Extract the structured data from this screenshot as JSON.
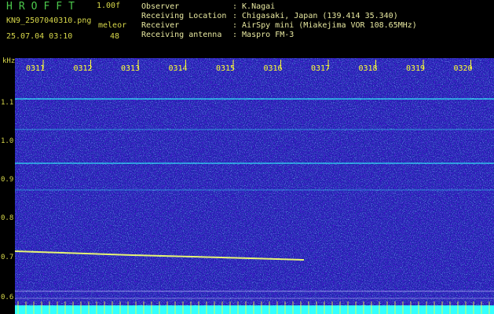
{
  "app": {
    "title": "HROFFT",
    "version": "1.00f"
  },
  "file": {
    "name": "KN9_2507040310.png",
    "mode": "meleor",
    "timestamp": "25.07.04 03:10",
    "count": "48"
  },
  "info": [
    {
      "key": "Observer",
      "value": ": K.Nagai"
    },
    {
      "key": "Receiving Location",
      "value": ": Chigasaki, Japan (139.414 35.340)"
    },
    {
      "key": "Receiver",
      "value": ": AirSpy mini (Miakejima VOR 108.65MHz)"
    },
    {
      "key": "Receiving antenna",
      "value": ": Maspro FM-3"
    }
  ],
  "axis": {
    "unit": "kHz",
    "y_ticks": [
      "1.1",
      "1.0",
      "0.9",
      "0.8",
      "0.7",
      "0.6"
    ],
    "time_ticks": [
      "0311",
      "0312",
      "0313",
      "0314",
      "0315",
      "0316",
      "0317",
      "0318",
      "0319",
      "0320"
    ]
  },
  "colors": {
    "background": "#1a22a8",
    "label": "#d8d84a",
    "tick": "#ffff33",
    "trail": "#f0ff70",
    "carrier": "#33ffff"
  }
}
